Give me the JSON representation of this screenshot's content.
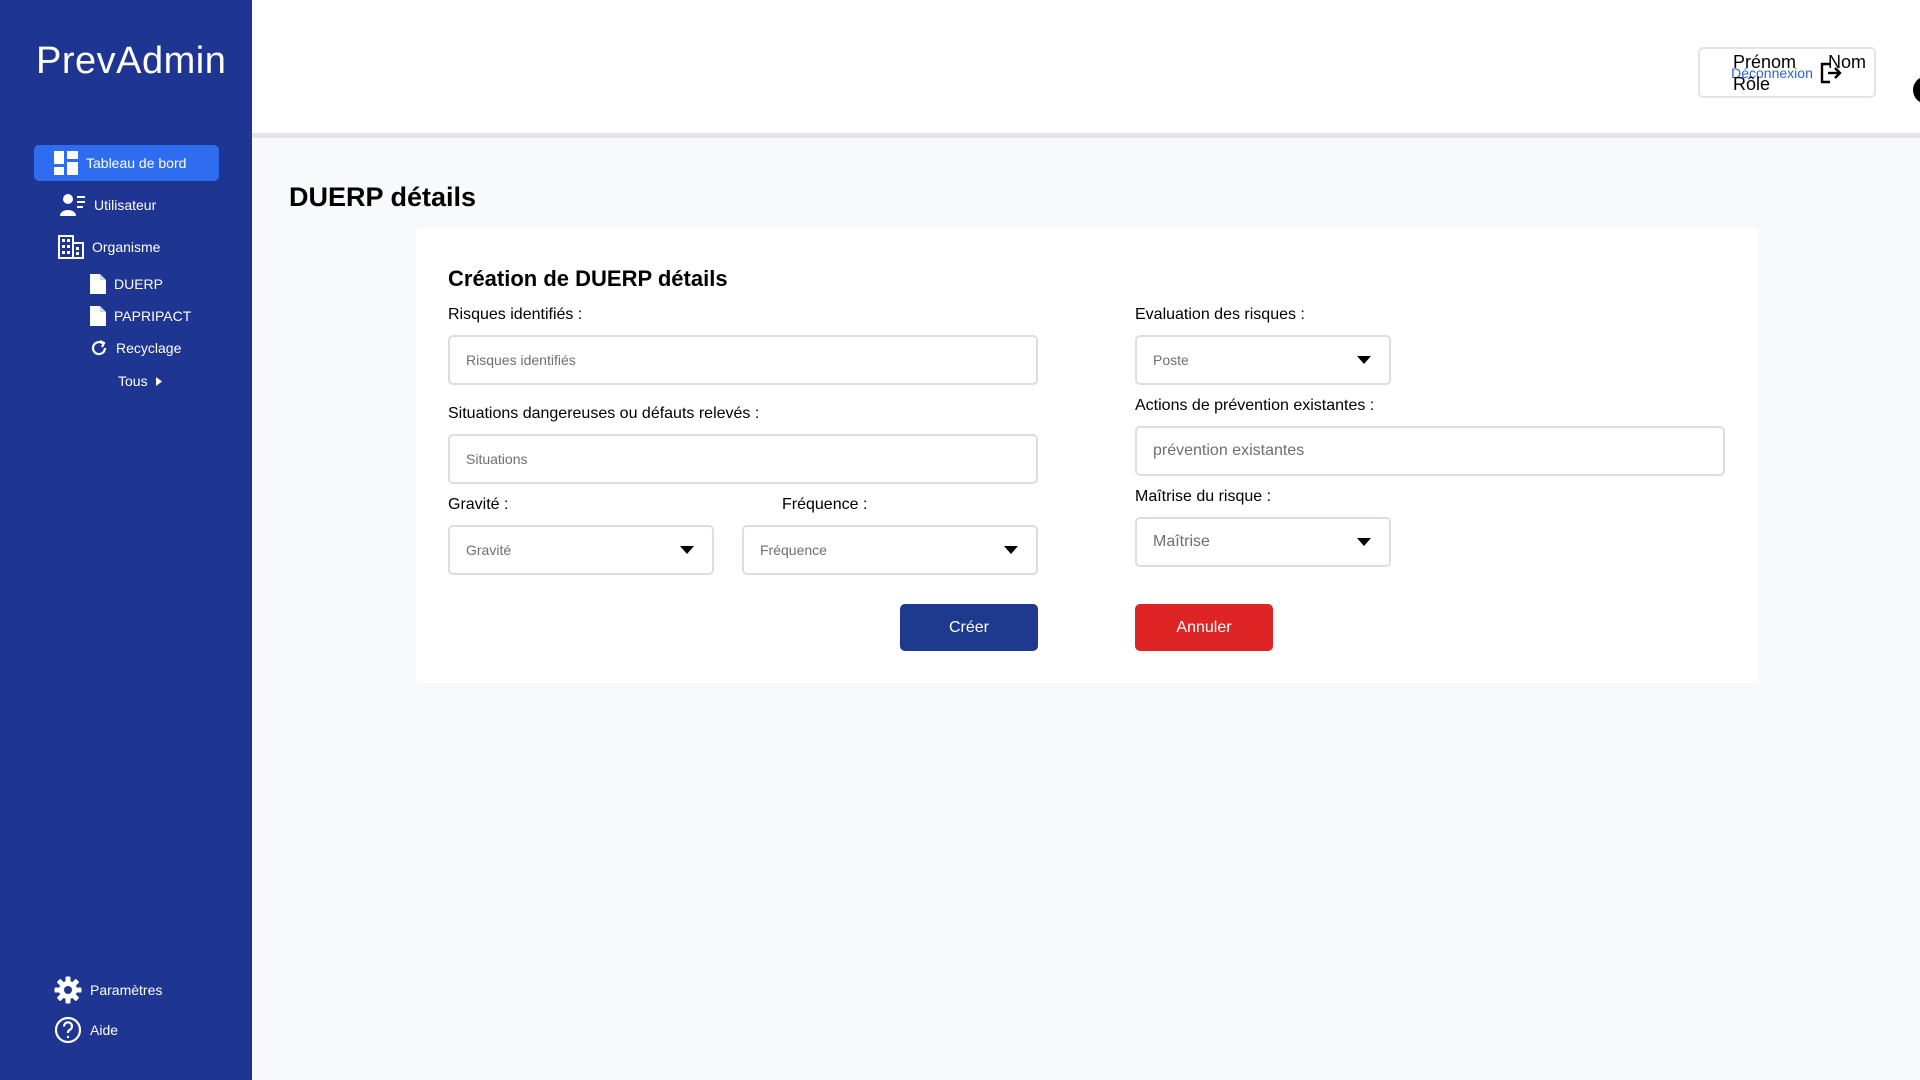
{
  "app": {
    "brand": "PrevAdmin"
  },
  "sidebar": {
    "items": [
      {
        "label": "Tableau de bord",
        "icon": "dashboard-icon",
        "active": true
      },
      {
        "label": "Utilisateur",
        "icon": "user-list-icon"
      },
      {
        "label": "Organisme",
        "icon": "building-icon"
      },
      {
        "label": "DUERP",
        "icon": "document-icon"
      },
      {
        "label": "PAPRIPACT",
        "icon": "document-icon"
      },
      {
        "label": "Recyclage",
        "icon": "refresh-icon"
      },
      {
        "label": "Tous",
        "icon": "caret-right-icon"
      }
    ],
    "bottom": [
      {
        "label": "Paramètres",
        "icon": "gear-icon"
      },
      {
        "label": "Aide",
        "icon": "help-icon"
      }
    ]
  },
  "header": {
    "logout_label": "Déconnexion",
    "user": {
      "first_name": "Prénom",
      "last_name": "Nom",
      "role": "Rôle"
    }
  },
  "main": {
    "page_title": "DUERP détails",
    "form": {
      "title": "Création de DUERP détails",
      "risques": {
        "label": "Risques identifiés :",
        "placeholder": "Risques identifiés"
      },
      "situations": {
        "label": "Situations dangereuses ou défauts relevés :",
        "placeholder": "Situations"
      },
      "gravite": {
        "label": "Gravité :",
        "value": "Gravité"
      },
      "frequence": {
        "label": "Fréquence :",
        "value": "Fréquence"
      },
      "evaluation": {
        "label": "Evaluation des risques :",
        "value": "Poste"
      },
      "actions": {
        "label": "Actions de prévention existantes :",
        "placeholder": "prévention existantes"
      },
      "maitrise": {
        "label": "Maîtrise du risque :",
        "value": "Maîtrise"
      },
      "create_label": "Créer",
      "cancel_label": "Annuler"
    }
  },
  "colors": {
    "sidebar": "#1f3592",
    "active": "#2e6cf0",
    "primary_button": "#1d3a8f",
    "danger_button": "#de2424",
    "link": "#2a63d8"
  }
}
